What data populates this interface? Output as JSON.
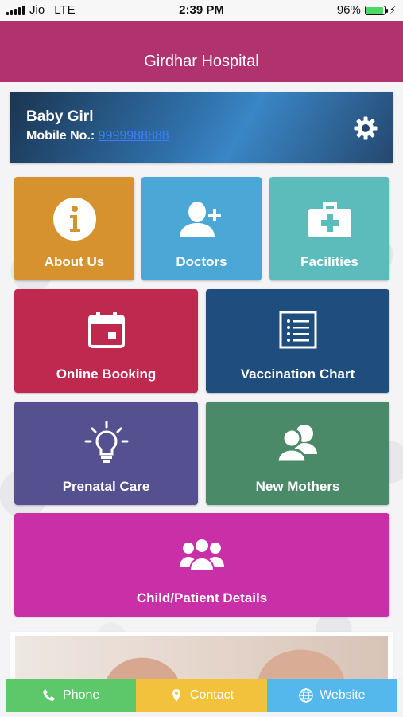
{
  "status_bar": {
    "carrier": "Jio",
    "network": "LTE",
    "time": "2:39 PM",
    "battery_percent": "96%",
    "battery_level": 0.96
  },
  "header": {
    "title": "Girdhar Hospital",
    "color": "#b0336f"
  },
  "profile": {
    "name": "Baby Girl",
    "mobile_label": "Mobile No.:",
    "mobile_number": "9999988888",
    "settings_icon": "gear-icon"
  },
  "tiles": [
    {
      "label": "About Us",
      "icon": "info-icon",
      "color": "#d6922f"
    },
    {
      "label": "Doctors",
      "icon": "add-user-icon",
      "color": "#4ba8d6"
    },
    {
      "label": "Facilities",
      "icon": "first-aid-kit-icon",
      "color": "#5cbcbc"
    },
    {
      "label": "Online Booking",
      "icon": "calendar-icon",
      "color": "#c0294f"
    },
    {
      "label": "Vaccination Chart",
      "icon": "checklist-icon",
      "color": "#1f4e7e"
    },
    {
      "label": "Prenatal Care",
      "icon": "lightbulb-icon",
      "color": "#55508f"
    },
    {
      "label": "New Mothers",
      "icon": "users-icon",
      "color": "#4a8a68"
    },
    {
      "label": "Child/Patient Details",
      "icon": "group-icon",
      "color": "#c92fa6"
    }
  ],
  "bottom_bar": [
    {
      "label": "Phone",
      "icon": "phone-icon",
      "color": "#5cc86a"
    },
    {
      "label": "Contact",
      "icon": "map-pin-icon",
      "color": "#f2c23c"
    },
    {
      "label": "Website",
      "icon": "globe-icon",
      "color": "#55b8ec"
    }
  ]
}
